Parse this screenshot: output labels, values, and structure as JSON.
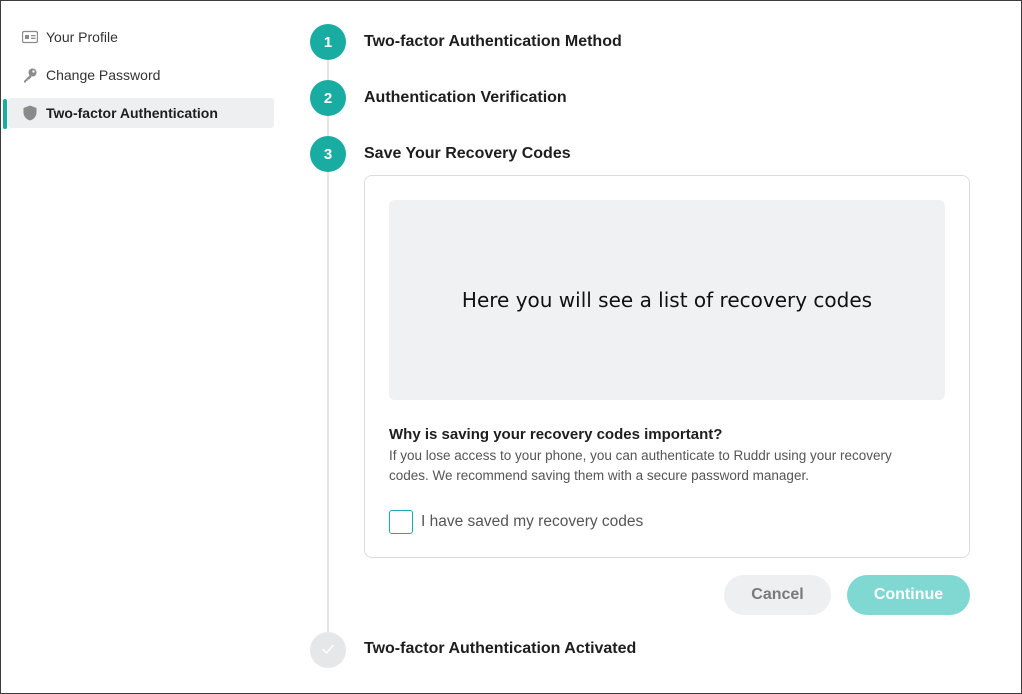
{
  "sidebar": {
    "items": [
      {
        "label": "Your Profile",
        "icon": "id-card-icon"
      },
      {
        "label": "Change Password",
        "icon": "key-icon"
      },
      {
        "label": "Two-factor Authentication",
        "icon": "shield-icon",
        "active": true
      }
    ]
  },
  "steps": [
    {
      "number": "1",
      "title": "Two-factor Authentication Method",
      "status": "complete"
    },
    {
      "number": "2",
      "title": "Authentication Verification",
      "status": "complete"
    },
    {
      "number": "3",
      "title": "Save Your Recovery Codes",
      "status": "current"
    },
    {
      "number": "",
      "title": "Two-factor Authentication Activated",
      "status": "pending",
      "icon": "check-icon"
    }
  ],
  "recovery": {
    "codes_placeholder": "Here you will see a list of recovery codes",
    "why_title": "Why is saving your recovery codes important?",
    "why_desc": "If you lose access to your phone, you can authenticate to Ruddr using your recovery codes. We recommend saving them with a secure password manager.",
    "checkbox_label": "I have saved my recovery codes",
    "checkbox_checked": false
  },
  "buttons": {
    "cancel": "Cancel",
    "continue": "Continue"
  },
  "colors": {
    "accent": "#19aca3",
    "accent_disabled": "#7fd8d2",
    "muted_bg": "#eeeff1"
  }
}
